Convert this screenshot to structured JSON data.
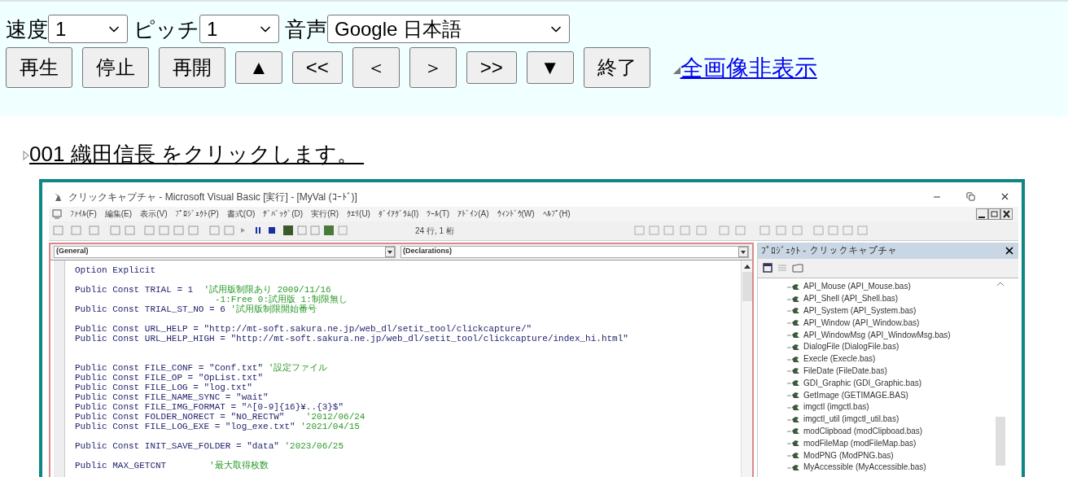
{
  "controls": [
    {
      "label": "速度",
      "value": "1",
      "kind": "narrow"
    },
    {
      "label": "ピッチ",
      "value": "1",
      "kind": "narrow"
    },
    {
      "label": "音声",
      "value": "Google 日本語",
      "kind": "wide"
    }
  ],
  "buttons": [
    {
      "label": "再生",
      "kind": "large"
    },
    {
      "label": "停止",
      "kind": "large"
    },
    {
      "label": "再開",
      "kind": "large"
    },
    {
      "label": "▲",
      "kind": "small"
    },
    {
      "label": "<<",
      "kind": "small"
    },
    {
      "label": "＜",
      "kind": "large"
    },
    {
      "label": "＞",
      "kind": "large"
    },
    {
      "label": ">>",
      "kind": "small"
    },
    {
      "label": "▼",
      "kind": "small"
    },
    {
      "label": "終了",
      "kind": "large"
    }
  ],
  "toggle_link": "全画像非表示",
  "step_link": "001 織田信長 をクリックします。",
  "screenshot": {
    "window_title": "クリックキャプチャ - Microsoft Visual Basic [実行] - [MyVal (ｺｰﾄﾞ)]",
    "menu": [
      "ﾌｧｲﾙ(F)",
      "編集(E)",
      "表示(V)",
      "ﾌﾟﾛｼﾞｪｸﾄ(P)",
      "書式(O)",
      "ﾃﾞﾊﾞｯｸﾞ(D)",
      "実行(R)",
      "ｸｴﾘ(U)",
      "ﾀﾞｲｱｸﾞﾗﾑ(I)",
      "ﾂｰﾙ(T)",
      "ｱﾄﾞｲﾝ(A)",
      "ｳｨﾝﾄﾞｳ(W)",
      "ﾍﾙﾌﾟ(H)"
    ],
    "cursor_position": "24 行, 1 桁",
    "object_combo": "(General)",
    "procedure_combo": "(Declarations)",
    "code": [
      {
        "kind": "code",
        "code": "Option Explicit"
      },
      {
        "kind": "blank"
      },
      {
        "kind": "code",
        "code": "Public Const TRIAL = 1  ",
        "comment": "'試用版制限あり 2009/11/16"
      },
      {
        "kind": "continuation",
        "comment": "-1:Free 0:試用版 1:制限無し"
      },
      {
        "kind": "code",
        "code": "Public Const TRIAL_ST_NO = 6 ",
        "comment": "'試用版制限開始番号"
      },
      {
        "kind": "blank"
      },
      {
        "kind": "code",
        "code": "Public Const URL_HELP = \"http://mt-soft.sakura.ne.jp/web_dl/setit_tool/clickcapture/\""
      },
      {
        "kind": "code",
        "code": "Public Const URL_HELP_HIGH = \"http://mt-soft.sakura.ne.jp/web_dl/setit_tool/clickcapture/index_hi.html\""
      },
      {
        "kind": "blank"
      },
      {
        "kind": "blank"
      },
      {
        "kind": "code",
        "code": "Public Const FILE_CONF = \"Conf.txt\" ",
        "comment": "'設定ファイル"
      },
      {
        "kind": "code",
        "code": "Public Const FILE_OP = \"OpList.txt\""
      },
      {
        "kind": "code",
        "code": "Public Const FILE_LOG = \"log.txt\""
      },
      {
        "kind": "code",
        "code": "Public Const FILE_NAME_SYNC = \"wait\""
      },
      {
        "kind": "code",
        "code": "Public Const FILE_IMG_FORMAT = \"^[0-9]{16}¥..{3}$\""
      },
      {
        "kind": "code",
        "code": "Public Const FOLDER_NORECT = \"NO_RECTW\"    ",
        "comment": "'2012/06/24"
      },
      {
        "kind": "code",
        "code": "Public Const FILE_LOG_EXE = \"log_exe.txt\" ",
        "comment": "'2021/04/15"
      },
      {
        "kind": "blank"
      },
      {
        "kind": "code",
        "code": "Public Const INIT_SAVE_FOLDER = \"data\" ",
        "comment": "'2023/06/25"
      },
      {
        "kind": "blank"
      },
      {
        "kind": "code",
        "code": "Public MAX_GETCNT        ",
        "comment": "'最大取得枚数"
      }
    ],
    "project": {
      "title": "ﾌﾟﾛｼﾞｪｸﾄ - クリックキャプチャ",
      "items": [
        "API_Mouse (API_Mouse.bas)",
        "API_Shell (API_Shell.bas)",
        "API_System (API_System.bas)",
        "API_Window (API_Window.bas)",
        "API_WindowMsg (API_WindowMsg.bas)",
        "DialogFile (DialogFile.bas)",
        "Execle (Execle.bas)",
        "FileDate (FileDate.bas)",
        "GDI_Graphic (GDI_Graphic.bas)",
        "GetImage (GETIMAGE.BAS)",
        "imgctl (imgctl.bas)",
        "imgctl_util (imgctl_util.bas)",
        "modClipboad (modClipboad.bas)",
        "modFileMap (modFileMap.bas)",
        "ModPNG (ModPNG.bas)",
        "MyAccessible (MyAccessible.bas)"
      ]
    }
  }
}
